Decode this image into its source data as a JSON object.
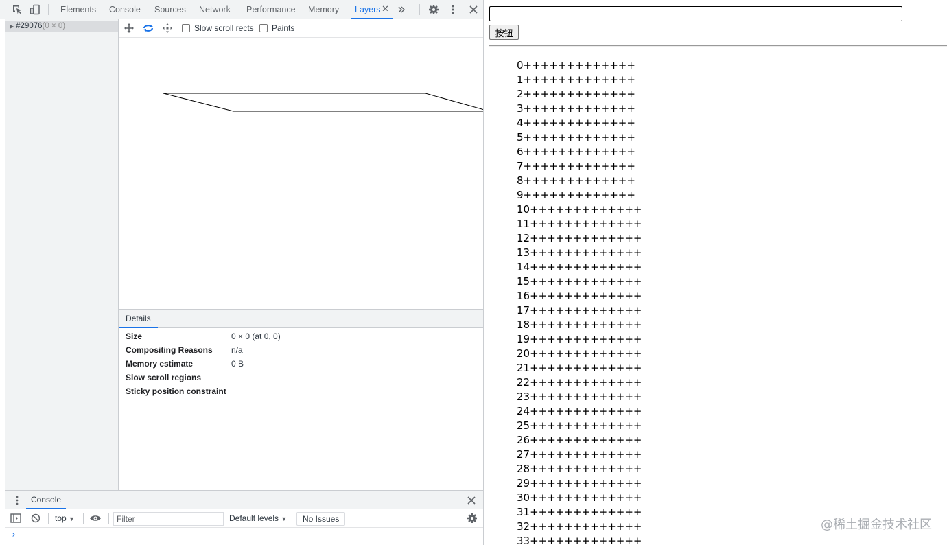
{
  "devtools": {
    "tabs": [
      {
        "label": "Elements"
      },
      {
        "label": "Console"
      },
      {
        "label": "Sources"
      },
      {
        "label": "Network"
      },
      {
        "label": "Performance"
      },
      {
        "label": "Memory"
      },
      {
        "label": "Layers"
      }
    ],
    "active_tab": "Layers",
    "more_tabs_icon": "double-chevron-icon",
    "layer_tree": {
      "id": "#29076",
      "size": "(0 × 0)"
    },
    "layers_toolbar": {
      "slow_scroll_label": "Slow scroll rects",
      "paints_label": "Paints"
    },
    "details": {
      "tab_label": "Details",
      "rows": [
        {
          "key": "Size",
          "value": "0 × 0 (at 0, 0)"
        },
        {
          "key": "Compositing Reasons",
          "value": "n/a"
        },
        {
          "key": "Memory estimate",
          "value": "0 B"
        },
        {
          "key": "Slow scroll regions",
          "value": ""
        },
        {
          "key": "Sticky position constraint",
          "value": ""
        }
      ]
    },
    "drawer": {
      "tab_label": "Console",
      "context": "top",
      "filter_placeholder": "Filter",
      "levels": "Default levels",
      "issues": "No Issues",
      "prompt": "›"
    },
    "colors": {
      "accent": "#1a73e8",
      "toolbar_bg": "#f1f3f4"
    }
  },
  "page": {
    "button_label": "按钮",
    "input_value": "",
    "lines": [
      "0+++++++++++++",
      "1+++++++++++++",
      "2+++++++++++++",
      "3+++++++++++++",
      "4+++++++++++++",
      "5+++++++++++++",
      "6+++++++++++++",
      "7+++++++++++++",
      "8+++++++++++++",
      "9+++++++++++++",
      "10+++++++++++++",
      "11+++++++++++++",
      "12+++++++++++++",
      "13+++++++++++++",
      "14+++++++++++++",
      "15+++++++++++++",
      "16+++++++++++++",
      "17+++++++++++++",
      "18+++++++++++++",
      "19+++++++++++++",
      "20+++++++++++++",
      "21+++++++++++++",
      "22+++++++++++++",
      "23+++++++++++++",
      "24+++++++++++++",
      "25+++++++++++++",
      "26+++++++++++++",
      "27+++++++++++++",
      "28+++++++++++++",
      "29+++++++++++++",
      "30+++++++++++++",
      "31+++++++++++++",
      "32+++++++++++++",
      "33+++++++++++++"
    ],
    "watermark": "@稀土掘金技术社区"
  }
}
